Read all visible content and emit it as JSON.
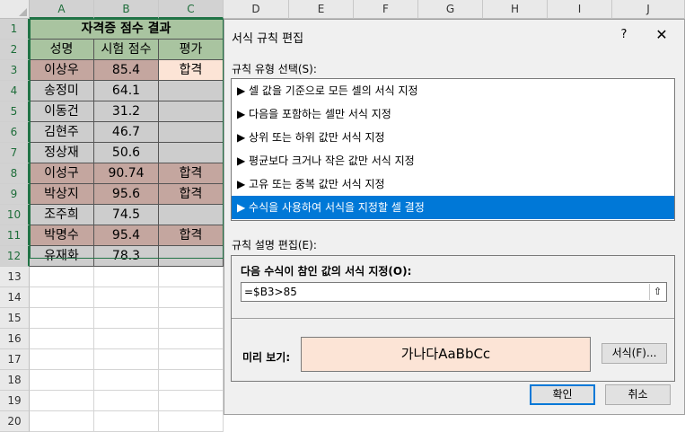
{
  "sheet": {
    "columns": [
      "A",
      "B",
      "C",
      "D",
      "E",
      "F",
      "G",
      "H",
      "I",
      "J"
    ],
    "rows": [
      "1",
      "2",
      "3",
      "4",
      "5",
      "6",
      "7",
      "8",
      "9",
      "10",
      "11",
      "12",
      "13",
      "14",
      "15",
      "16",
      "17",
      "18",
      "19",
      "20"
    ],
    "title": "자격증 점수 결과",
    "headers": [
      "성명",
      "시험 점수",
      "평가"
    ],
    "data": [
      {
        "name": "이상우",
        "score": "85.4",
        "result": "합격"
      },
      {
        "name": "송정미",
        "score": "64.1",
        "result": ""
      },
      {
        "name": "이동건",
        "score": "31.2",
        "result": ""
      },
      {
        "name": "김현주",
        "score": "46.7",
        "result": ""
      },
      {
        "name": "정상재",
        "score": "50.6",
        "result": ""
      },
      {
        "name": "이성구",
        "score": "90.74",
        "result": "합격"
      },
      {
        "name": "박상지",
        "score": "95.6",
        "result": "합격"
      },
      {
        "name": "조주희",
        "score": "74.5",
        "result": ""
      },
      {
        "name": "박명수",
        "score": "95.4",
        "result": "합격"
      },
      {
        "name": "유재화",
        "score": "78.3",
        "result": ""
      }
    ],
    "colors": {
      "title_bg": "#a9c4a0",
      "header_bg": "#a9c4a0",
      "pass_bg": "#c4a69f",
      "fail_bg": "#cdcdcd",
      "first_result_bg": "#fce4d6",
      "selected_header": "#217346"
    }
  },
  "dialog": {
    "title": "서식 규칙 편집",
    "help": "?",
    "close": "✕",
    "rule_type_label": "규칙 유형 선택(S):",
    "rule_types": [
      "▶ 셀 값을 기준으로 모든 셀의 서식 지정",
      "▶ 다음을 포함하는 셀만 서식 지정",
      "▶ 상위 또는 하위 값만 서식 지정",
      "▶ 평균보다 크거나 작은 값만 서식 지정",
      "▶ 고유 또는 중복 값만 서식 지정",
      "▶ 수식을 사용하여 서식을 지정할 셀 결정"
    ],
    "selected_rule_index": 5,
    "rule_desc_label": "규칙 설명 편집(E):",
    "formula_label": "다음 수식이 참인 값의 서식 지정(O):",
    "formula_value": "=$B3>85",
    "ref_icon": "⇧",
    "preview_label": "미리 보기:",
    "preview_text": "가나다AaBbCc",
    "preview_color": "#fce4d6",
    "format_button": "서식(F)...",
    "ok_button": "확인",
    "cancel_button": "취소"
  }
}
